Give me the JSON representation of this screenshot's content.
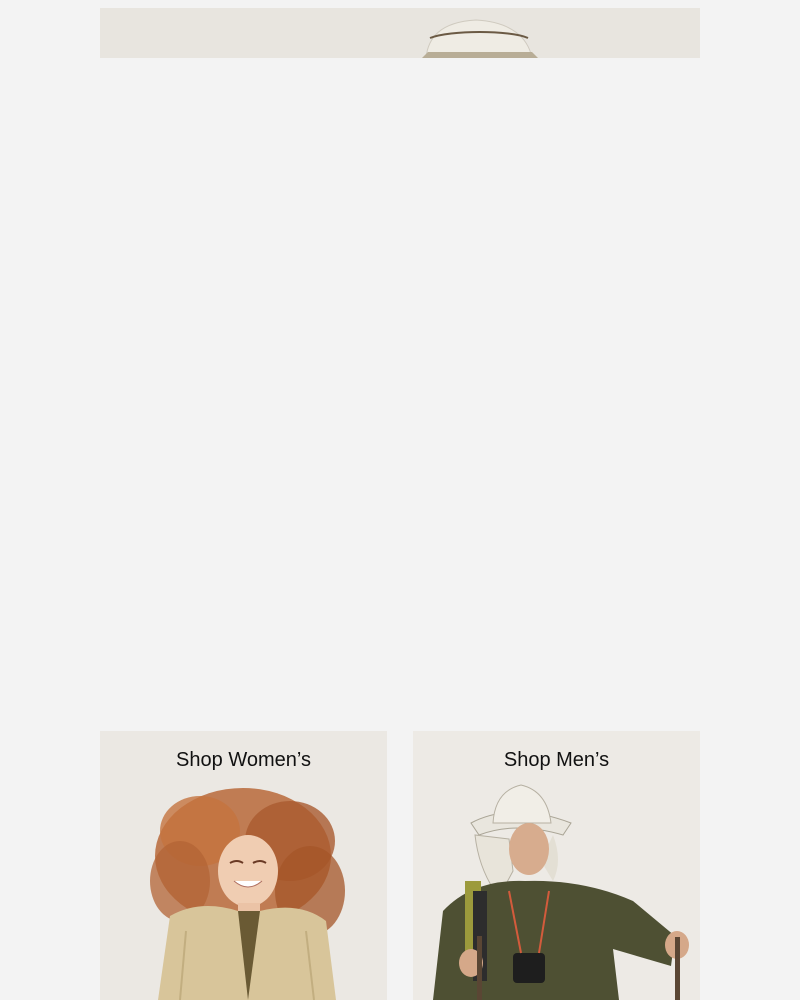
{
  "promo": {
    "shop_womens_label": "Shop Women’s",
    "shop_mens_label": "Shop Men’s"
  },
  "colors": {
    "page_background": "#f3f3f3",
    "tile_background": "#ebe8e3",
    "label_text": "#111111"
  },
  "images": {
    "hero": "hero-photo-hat-crown",
    "womens": "womens-model-photo",
    "mens": "mens-model-photo"
  }
}
